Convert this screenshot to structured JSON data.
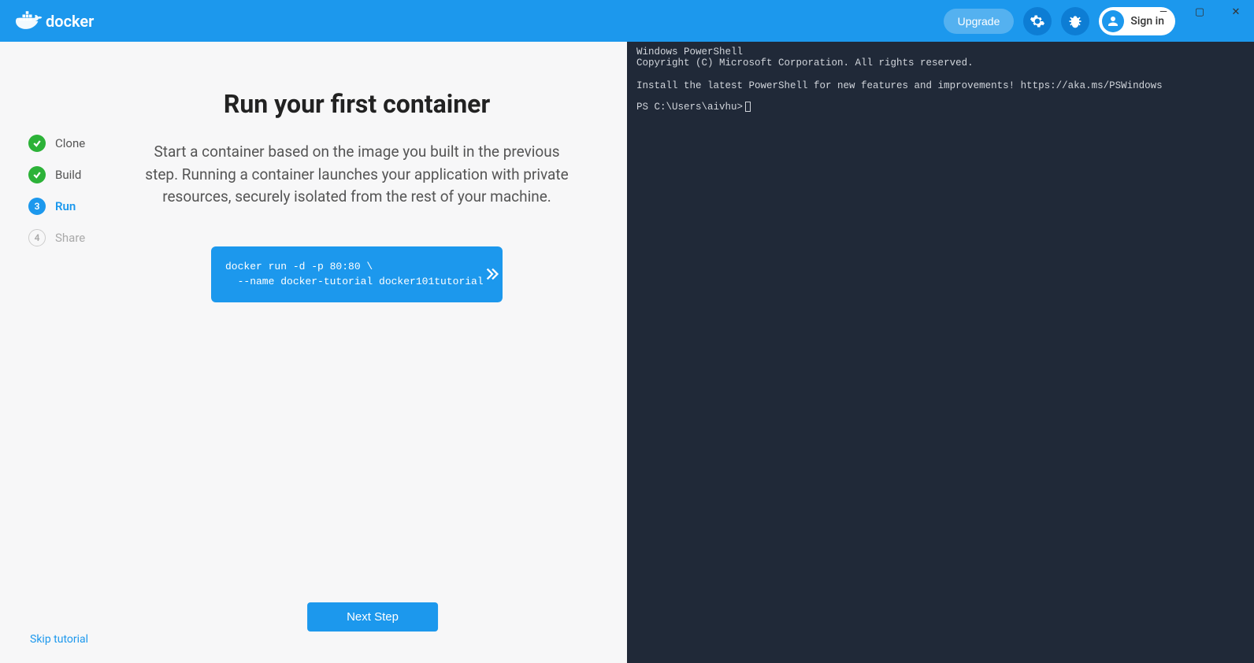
{
  "app": {
    "name": "docker"
  },
  "titlebar": {
    "minimize": "—",
    "maximize": "▢",
    "close": "✕"
  },
  "header": {
    "upgrade_label": "Upgrade",
    "signin_label": "Sign in"
  },
  "steps": [
    {
      "label": "Clone",
      "state": "done"
    },
    {
      "label": "Build",
      "state": "done"
    },
    {
      "label": "Run",
      "state": "active",
      "number": "3"
    },
    {
      "label": "Share",
      "state": "pending",
      "number": "4"
    }
  ],
  "content": {
    "title": "Run your first container",
    "description": "Start a container based on the image you built in the previous step. Running a container launches your application with private resources, securely isolated from the rest of your machine.",
    "command": "docker run -d -p 80:80 \\\n  --name docker-tutorial docker101tutorial",
    "next_label": "Next Step",
    "skip_label": "Skip tutorial"
  },
  "terminal": {
    "line1": "Windows PowerShell",
    "line2": "Copyright (C) Microsoft Corporation. All rights reserved.",
    "line3": "Install the latest PowerShell for new features and improvements! https://aka.ms/PSWindows",
    "prompt": "PS C:\\Users\\aivhu>"
  },
  "colors": {
    "accent": "#1c98ed",
    "success": "#2cb238",
    "terminal_bg": "#202938"
  }
}
